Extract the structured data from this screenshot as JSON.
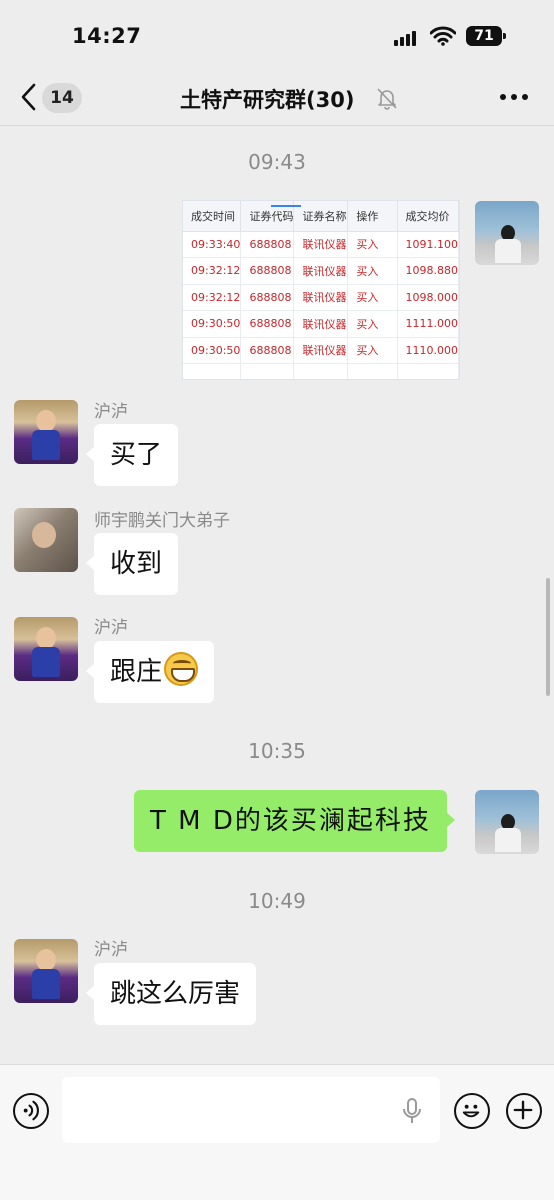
{
  "status": {
    "time": "14:27",
    "battery": "71"
  },
  "header": {
    "back_count": "14",
    "title": "土特产研究群(30)"
  },
  "messages": {
    "ts1": "09:43",
    "ts2": "10:35",
    "ts3": "10:49",
    "m1_sender": "沪泸",
    "m1_text": "买了",
    "m2_sender": "师宇鹏关门大弟子",
    "m2_text": "收到",
    "m3_sender": "沪泸",
    "m3_text": "跟庄",
    "m4_text": "T M D的该买澜起科技",
    "m5_sender": "沪泸",
    "m5_text": "跳这么厉害"
  },
  "trade_table": {
    "headers": [
      "成交时间",
      "证券代码",
      "证券名称",
      "操作",
      "成交均价"
    ],
    "rows": [
      [
        "09:33:40",
        "688808",
        "联讯仪器",
        "买入",
        "1091.100"
      ],
      [
        "09:32:12",
        "688808",
        "联讯仪器",
        "买入",
        "1098.880"
      ],
      [
        "09:32:12",
        "688808",
        "联讯仪器",
        "买入",
        "1098.000"
      ],
      [
        "09:30:50",
        "688808",
        "联讯仪器",
        "买入",
        "1111.000"
      ],
      [
        "09:30:50",
        "688808",
        "联讯仪器",
        "买入",
        "1110.000"
      ]
    ]
  },
  "colors": {
    "my_bubble": "#95ec69",
    "buy_red": "#c8262b",
    "background": "#ededed"
  },
  "icons": [
    "back-icon",
    "mute-icon",
    "more-icon",
    "voice-icon",
    "mic-icon",
    "emoji-icon",
    "plus-icon"
  ]
}
